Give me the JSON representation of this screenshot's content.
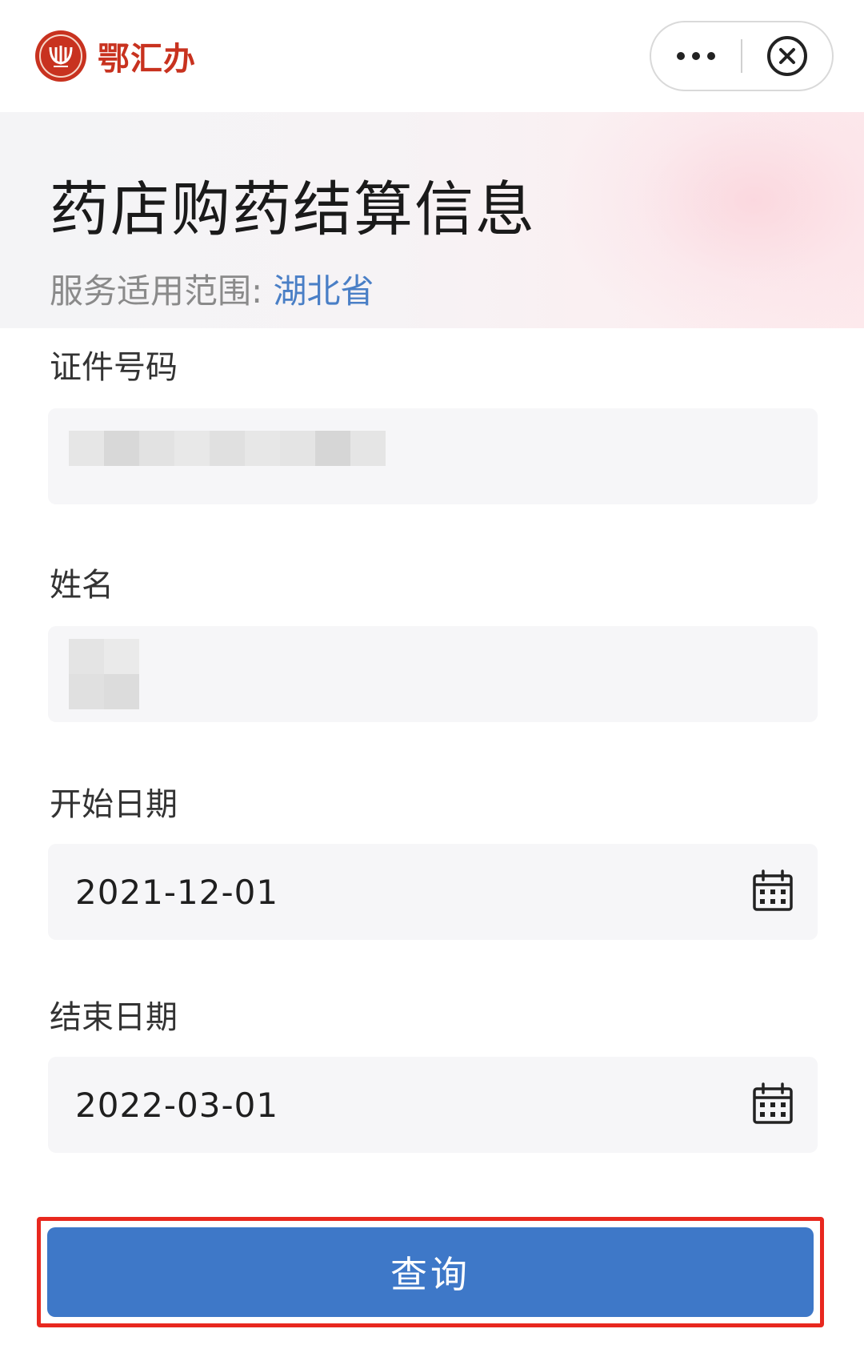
{
  "topbar": {
    "brand_name": "鄂汇办",
    "more_icon": "more-dots-icon",
    "close_icon": "close-circle-icon",
    "brand_color": "#c8321f"
  },
  "header": {
    "title": "药店购药结算信息",
    "scope_label": "服务适用范围:",
    "scope_value": "湖北省",
    "scope_color": "#4a7fc6"
  },
  "form": {
    "id_number": {
      "label": "证件号码",
      "value_redacted": true
    },
    "name": {
      "label": "姓名",
      "value_redacted": true
    },
    "start_date": {
      "label": "开始日期",
      "value": "2021-12-01",
      "icon": "calendar-icon"
    },
    "end_date": {
      "label": "结束日期",
      "value": "2022-03-01",
      "icon": "calendar-icon"
    }
  },
  "actions": {
    "query_label": "查询",
    "button_color": "#3e78c8",
    "highlight_color": "#e8281f"
  }
}
